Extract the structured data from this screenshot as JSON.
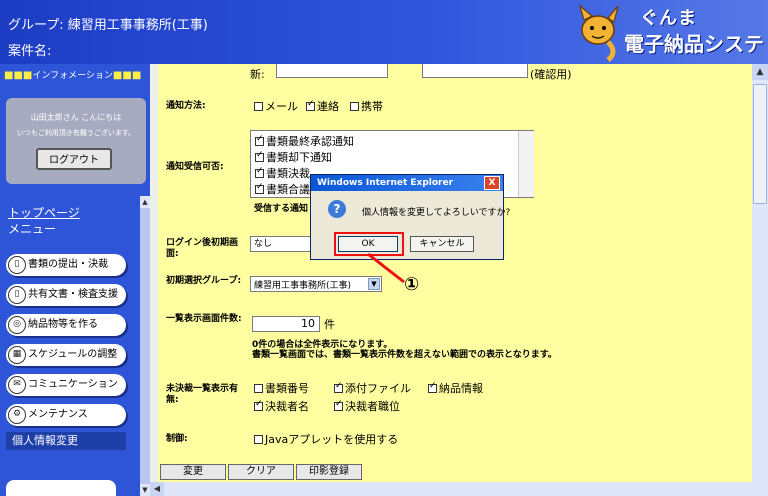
{
  "header": {
    "group": "グループ: 練習用工事事務所(工事)",
    "anken": "案件名:",
    "brand_line1": "ぐんま",
    "brand_line2": "電子納品システム"
  },
  "sidebar": {
    "info_title": "インフォメーション",
    "greeting": "山田太郎さん こんにちは",
    "thanks": "いつもご利用頂き有難うございます。",
    "logout": "ログアウト",
    "top_page": "トップページ",
    "menu": "メニュー",
    "items": [
      {
        "label": "書類の提出・決裁",
        "icon": "document-icon"
      },
      {
        "label": "共有文書・検査支援",
        "icon": "shared-document-icon"
      },
      {
        "label": "納品物等を作る",
        "icon": "disc-icon"
      },
      {
        "label": "スケジュールの調整",
        "icon": "calendar-icon"
      },
      {
        "label": "コミュニケーション",
        "icon": "mail-icon"
      },
      {
        "label": "メンテナンス",
        "icon": "wrench-icon"
      }
    ],
    "current": "個人情報変更"
  },
  "form": {
    "row0_left": "新:",
    "row0_right": "(確認用)",
    "notify_method_label": "通知方法:",
    "notify_method": [
      {
        "label": "メール",
        "checked": false
      },
      {
        "label": "連絡",
        "checked": true
      },
      {
        "label": "携帯",
        "checked": false
      }
    ],
    "notify_recv_label": "通知受信可否:",
    "notify_recv_items": [
      "書類最終承認通知",
      "書類却下通知",
      "書類決裁",
      "書類合議"
    ],
    "notify_recv_note": "受信する通知",
    "login_page_label": "ログイン後初期画面:",
    "login_page_value": "なし",
    "init_group_label": "初期選択グループ:",
    "init_group_value": "練習用工事事務所(工事)",
    "list_count_label": "一覧表示画面件数:",
    "list_count_value": "10",
    "list_count_unit": "件",
    "list_count_note1": "0件の場合は全件表示になります。",
    "list_count_note2": "書類一覧画面では、書類一覧表示件数を超えない範囲での表示となります。",
    "pending_label": "未決裁一覧表示有無:",
    "pending_items": [
      {
        "label": "書類番号",
        "checked": false
      },
      {
        "label": "添付ファイル",
        "checked": true
      },
      {
        "label": "納品情報",
        "checked": true
      },
      {
        "label": "決裁者名",
        "checked": true
      },
      {
        "label": "決裁者職位",
        "checked": true
      }
    ],
    "control_label": "制御:",
    "control_item": {
      "label": "Javaアプレットを使用する",
      "checked": false
    }
  },
  "buttons": {
    "change": "変更",
    "clear": "クリア",
    "seal": "印影登録"
  },
  "dialog": {
    "title": "Windows Internet Explorer",
    "message": "個人情報を変更してよろしいですか?",
    "ok": "OK",
    "cancel": "キャンセル",
    "close": "X",
    "callout": "①"
  }
}
